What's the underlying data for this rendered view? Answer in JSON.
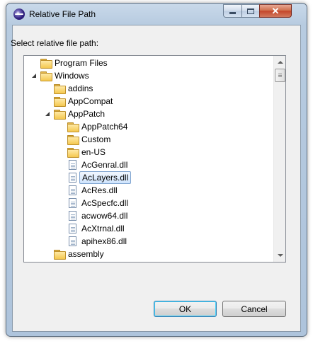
{
  "window": {
    "title": "Relative File Path",
    "controls": {
      "minimize": "",
      "maximize": "",
      "close": "✕"
    }
  },
  "prompt": "Select relative file path:",
  "tree": {
    "rows": [
      {
        "label": "Program Files",
        "type": "folder",
        "depth": 0,
        "expander": "collapsed"
      },
      {
        "label": "Windows",
        "type": "folder",
        "depth": 0,
        "expander": "expanded"
      },
      {
        "label": "addins",
        "type": "folder",
        "depth": 1,
        "expander": "none"
      },
      {
        "label": "AppCompat",
        "type": "folder",
        "depth": 1,
        "expander": "collapsed"
      },
      {
        "label": "AppPatch",
        "type": "folder",
        "depth": 1,
        "expander": "expanded"
      },
      {
        "label": "AppPatch64",
        "type": "folder",
        "depth": 2,
        "expander": "collapsed"
      },
      {
        "label": "Custom",
        "type": "folder",
        "depth": 2,
        "expander": "collapsed"
      },
      {
        "label": "en-US",
        "type": "folder",
        "depth": 2,
        "expander": "collapsed"
      },
      {
        "label": "AcGenral.dll",
        "type": "file",
        "depth": 2,
        "expander": "none"
      },
      {
        "label": "AcLayers.dll",
        "type": "file",
        "depth": 2,
        "expander": "none",
        "selected": true
      },
      {
        "label": "AcRes.dll",
        "type": "file",
        "depth": 2,
        "expander": "none"
      },
      {
        "label": "AcSpecfc.dll",
        "type": "file",
        "depth": 2,
        "expander": "none"
      },
      {
        "label": "acwow64.dll",
        "type": "file",
        "depth": 2,
        "expander": "none"
      },
      {
        "label": "AcXtrnal.dll",
        "type": "file",
        "depth": 2,
        "expander": "none"
      },
      {
        "label": "apihex86.dll",
        "type": "file",
        "depth": 2,
        "expander": "none"
      },
      {
        "label": "assembly",
        "type": "folder",
        "depth": 1,
        "expander": "collapsed"
      }
    ]
  },
  "buttons": {
    "ok": "OK",
    "cancel": "Cancel"
  },
  "colors": {
    "selection": "#cfe4fd",
    "folder": "#f5c84f",
    "close_button": "#c4452a"
  }
}
